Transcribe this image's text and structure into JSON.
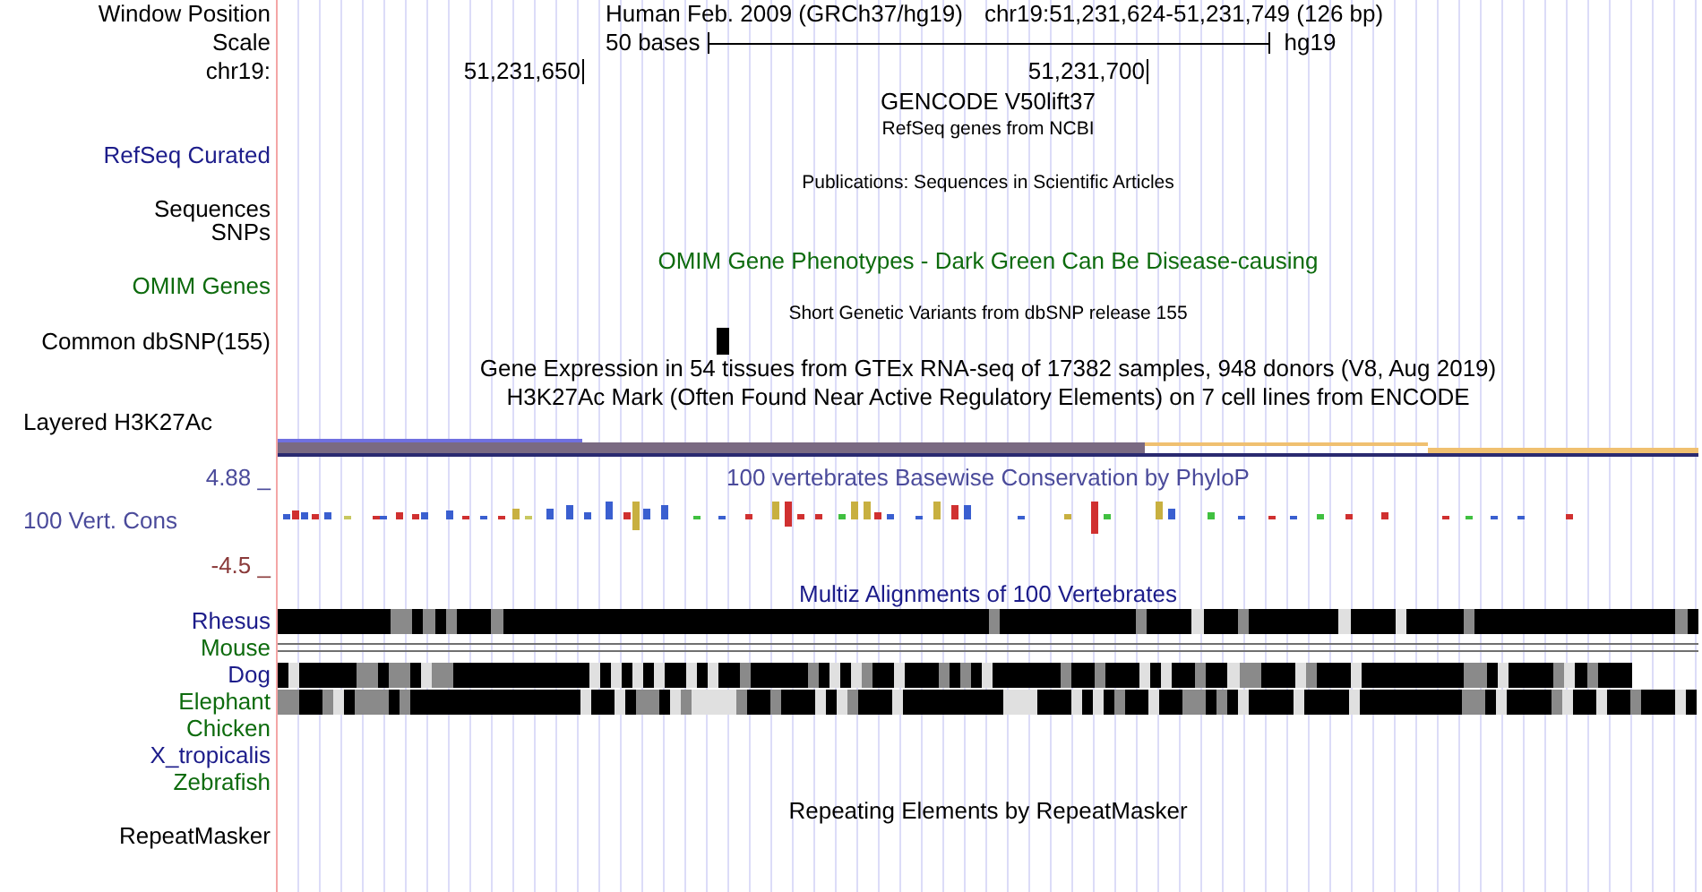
{
  "header": {
    "position_label": "Window Position",
    "assembly_title": "Human Feb. 2009 (GRCh37/hg19)",
    "position": "chr19:51,231,624-51,231,749 (126 bp)",
    "scale_label": "Scale",
    "scale_text": "50 bases",
    "scale_assembly": "hg19",
    "chrom_label": "chr19:",
    "ticks": [
      "51,231,650",
      "51,231,700"
    ]
  },
  "tracks": [
    {
      "kind": "title",
      "text": "GENCODE V50lift37",
      "color": "#000000"
    },
    {
      "kind": "caption",
      "text": "RefSeq genes from NCBI"
    },
    {
      "kind": "label",
      "label": "RefSeq Curated",
      "color": "#1c1c8a"
    },
    {
      "kind": "caption",
      "text": "Publications: Sequences in Scientific Articles"
    },
    {
      "kind": "label",
      "label": "Sequences",
      "color": "#000000"
    },
    {
      "kind": "label",
      "label": "SNPs",
      "color": "#000000"
    },
    {
      "kind": "title",
      "text": "OMIM Gene Phenotypes - Dark Green Can Be Disease-causing",
      "color": "#0d6b0d"
    },
    {
      "kind": "label",
      "label": "OMIM Genes",
      "color": "#0d6b0d"
    },
    {
      "kind": "caption",
      "text": "Short Genetic Variants from dbSNP release 155"
    },
    {
      "kind": "snp",
      "label": "Common dbSNP(155)",
      "color": "#000000"
    },
    {
      "kind": "title",
      "text": "Gene Expression in 54 tissues from GTEx RNA-seq of 17382 samples, 948 donors (V8, Aug 2019)",
      "color": "#000000"
    },
    {
      "kind": "title",
      "text": "H3K27Ac Mark (Often Found Near Active Regulatory Elements) on 7 cell lines from ENCODE",
      "color": "#000000"
    },
    {
      "kind": "signal",
      "label": "Layered H3K27Ac",
      "color": "#000000"
    },
    {
      "kind": "conservation",
      "label": "100 Vert. Cons",
      "color": "#4b4b9b",
      "max_label": "4.88 _",
      "min_label": "-4.5 _",
      "title": "100 vertebrates Basewise Conservation by PhyloP"
    },
    {
      "kind": "title",
      "text": "Multiz Alignments of 100 Vertebrates",
      "color": "#1c1c8a"
    },
    {
      "kind": "blocks",
      "label": "Rhesus",
      "color": "#1c1c8a"
    },
    {
      "kind": "gaps",
      "label": "Mouse",
      "color": "#0d6b0d"
    },
    {
      "kind": "blocks",
      "label": "Dog",
      "color": "#1c1c8a"
    },
    {
      "kind": "blocks",
      "label": "Elephant",
      "color": "#0d6b0d"
    },
    {
      "kind": "empty",
      "label": "Chicken",
      "color": "#0d6b0d"
    },
    {
      "kind": "empty",
      "label": "X_tropicalis",
      "color": "#1c1c8a"
    },
    {
      "kind": "empty",
      "label": "Zebrafish",
      "color": "#0d6b0d"
    },
    {
      "kind": "title",
      "text": "Repeating Elements by RepeatMasker",
      "color": "#000000"
    },
    {
      "kind": "label",
      "label": "RepeatMasker",
      "color": "#000000"
    }
  ]
}
